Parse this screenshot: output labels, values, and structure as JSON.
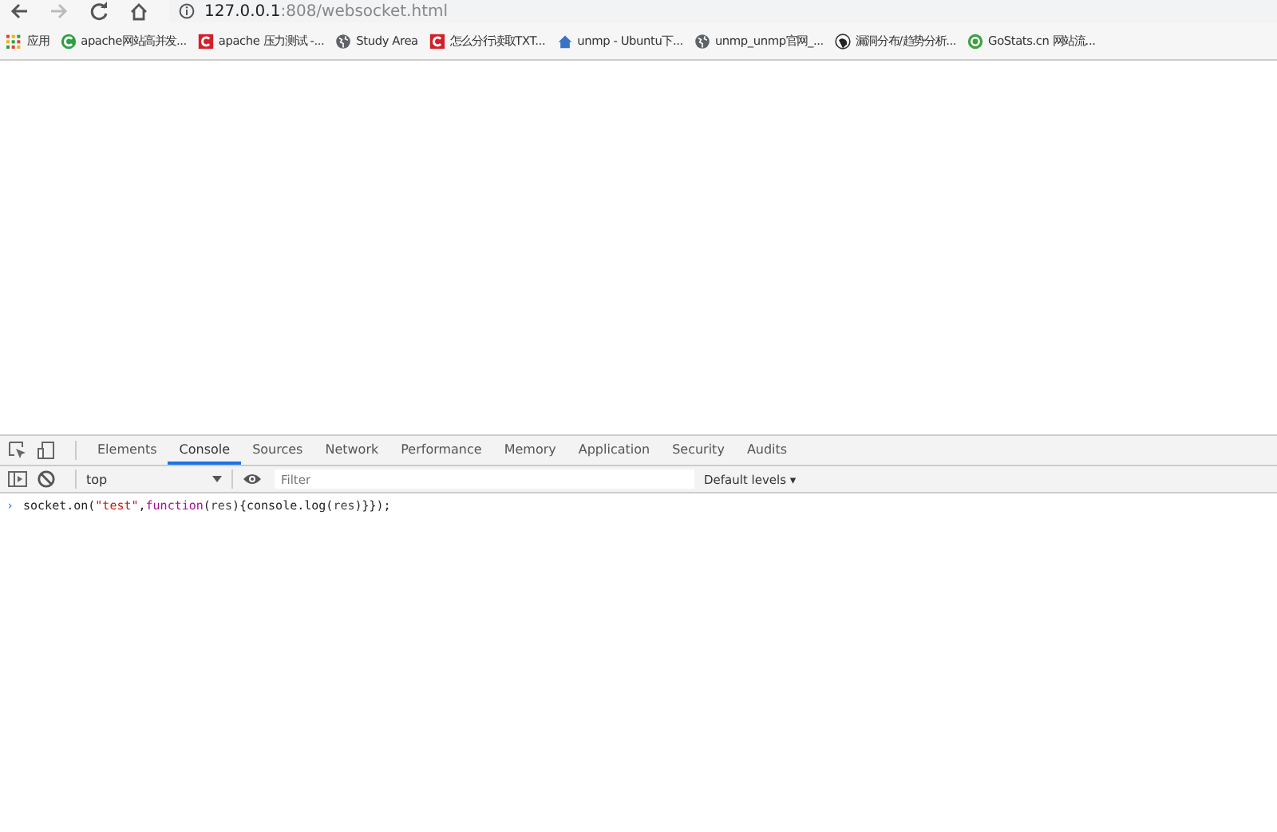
{
  "address_bar": {
    "host": "127.0.0.1",
    "path": ":808/websocket.html"
  },
  "bookmarks": [
    {
      "kind": "apps",
      "label": "应用"
    },
    {
      "kind": "cgreen",
      "label": "apache网站高并发..."
    },
    {
      "kind": "cred",
      "label": "apache 压力测试 -..."
    },
    {
      "kind": "globe",
      "label": "Study Area"
    },
    {
      "kind": "cred",
      "label": "怎么分行读取TXT..."
    },
    {
      "kind": "home",
      "label": "unmp - Ubuntu下..."
    },
    {
      "kind": "globe",
      "label": "unmp_unmp官网_..."
    },
    {
      "kind": "dark",
      "label": "漏洞分布/趋势分析..."
    },
    {
      "kind": "ggreen",
      "label": "GoStats.cn 网站流..."
    }
  ],
  "devtools": {
    "tabs": [
      {
        "label": "Elements",
        "selected": false
      },
      {
        "label": "Console",
        "selected": true
      },
      {
        "label": "Sources",
        "selected": false
      },
      {
        "label": "Network",
        "selected": false
      },
      {
        "label": "Performance",
        "selected": false
      },
      {
        "label": "Memory",
        "selected": false
      },
      {
        "label": "Application",
        "selected": false
      },
      {
        "label": "Security",
        "selected": false
      },
      {
        "label": "Audits",
        "selected": false
      }
    ],
    "context": "top",
    "filter": {
      "placeholder": "Filter"
    },
    "levels": "Default levels ▾",
    "console_lines": [
      {
        "prompt": "›",
        "tokens": [
          {
            "kind": "plain",
            "text": "socket.on("
          },
          {
            "kind": "string",
            "text": "\"test\""
          },
          {
            "kind": "plain",
            "text": ","
          },
          {
            "kind": "keyword",
            "text": "function"
          },
          {
            "kind": "plain",
            "text": "("
          },
          {
            "kind": "param",
            "text": "res"
          },
          {
            "kind": "plain",
            "text": "){console.log("
          },
          {
            "kind": "param",
            "text": "res"
          },
          {
            "kind": "plain",
            "text": ")}});"
          }
        ]
      }
    ]
  }
}
